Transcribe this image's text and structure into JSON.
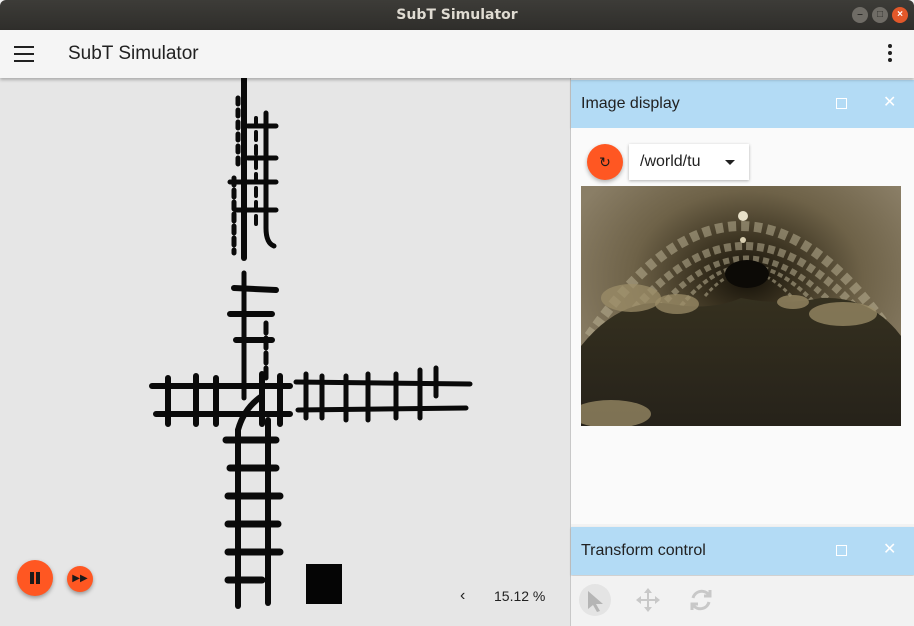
{
  "window": {
    "title": "SubT Simulator"
  },
  "appbar": {
    "title": "SubT Simulator"
  },
  "scene": {
    "zoom": "15.12 %",
    "zoom_chevron": "‹"
  },
  "image_display": {
    "title": "Image display",
    "topic": "/world/tu",
    "refresh_glyph": "↻",
    "close_glyph": "✕"
  },
  "transform_control": {
    "title": "Transform control",
    "close_glyph": "✕"
  },
  "colors": {
    "accent": "#ff5722",
    "panel_header": "#b3dbf5",
    "titlebar": "#33322f",
    "scene_bg": "#e6e6e6"
  },
  "icons": [
    "menu-icon",
    "more-vert-icon",
    "pause-icon",
    "fast-forward-icon",
    "refresh-icon",
    "chevron-left-icon",
    "select-arrow-icon",
    "translate-icon",
    "rotate-icon"
  ]
}
